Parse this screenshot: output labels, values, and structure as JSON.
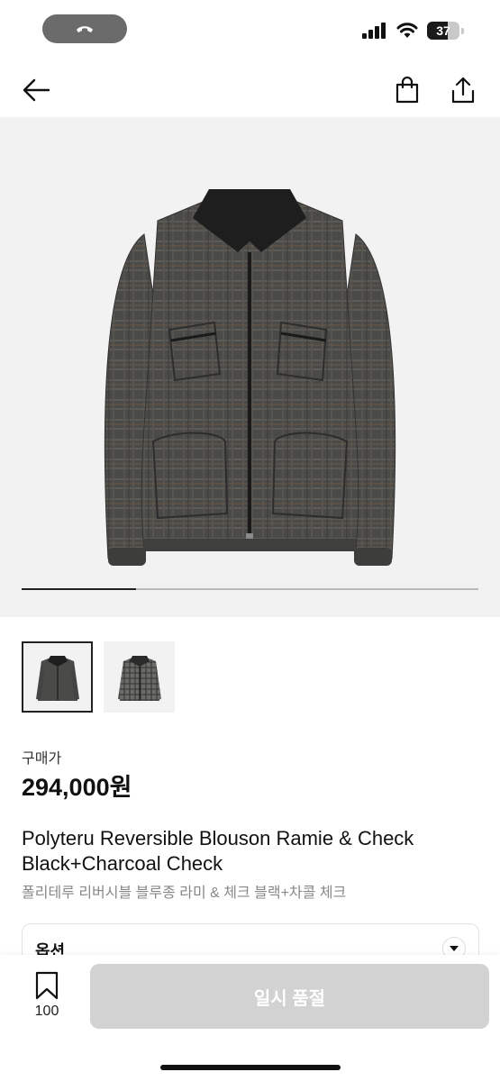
{
  "status_bar": {
    "battery": "37",
    "battery_level": 0.37,
    "call_pill_color": "#6b6b6b"
  },
  "nav": {
    "icons": [
      "arrow-left-icon",
      "shopping-bag-icon",
      "share-icon"
    ]
  },
  "gallery": {
    "image_count": 2,
    "current_index": 1,
    "progress_fraction": 0.25
  },
  "price": {
    "label": "구매가",
    "value": "294,000원"
  },
  "product": {
    "title_en": "Polyteru Reversible Blouson Ramie & Check Black+Charcoal Check",
    "title_ko": "폴리테루 리버시블 블루종 라미 & 체크 블랙+차콜 체크"
  },
  "option": {
    "label": "옵션"
  },
  "bottom_bar": {
    "wish_count": "100",
    "soldout_label": "일시 품절",
    "soldout_color": "#d2d2d2"
  }
}
